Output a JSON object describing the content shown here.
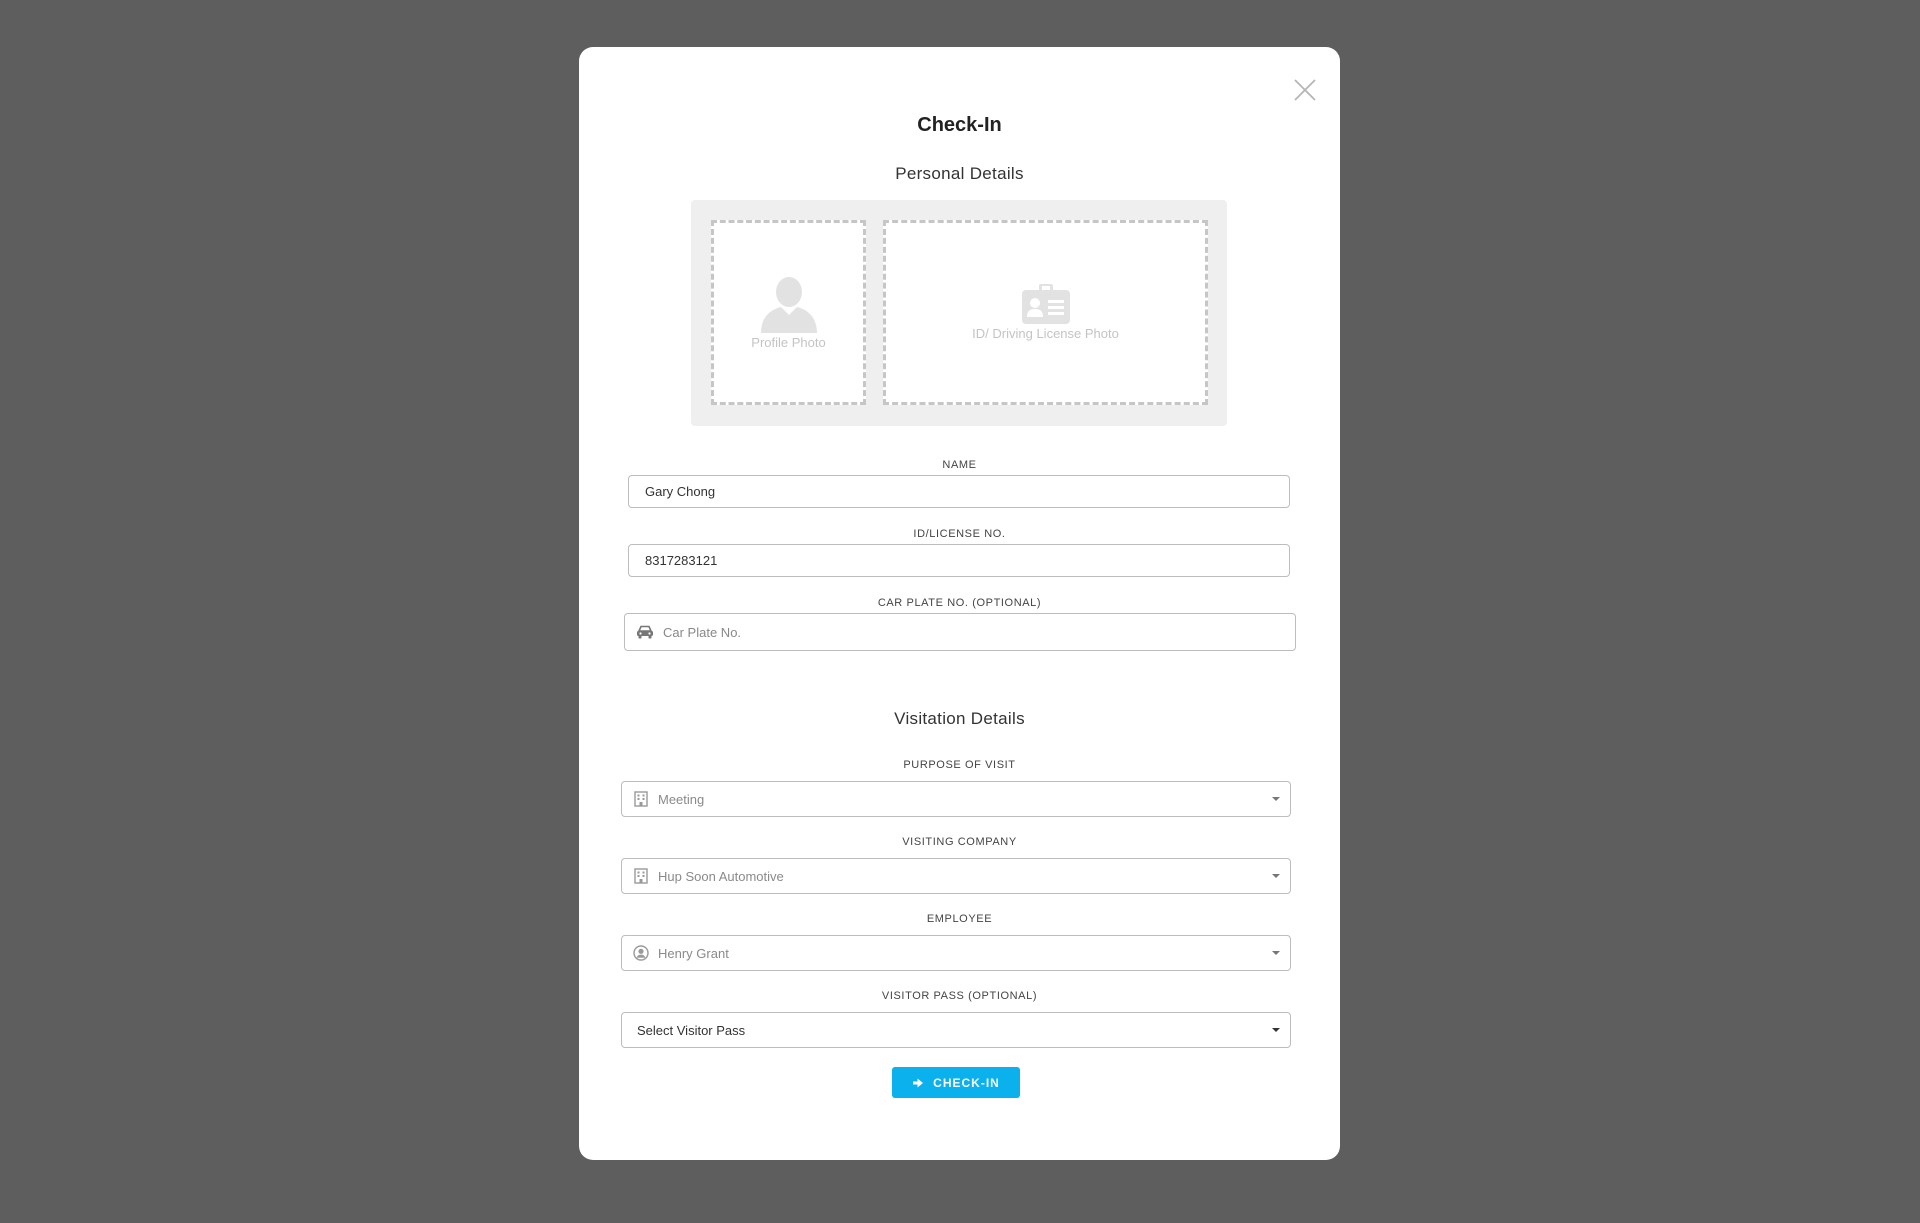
{
  "modal": {
    "title": "Check-In",
    "personal_section_title": "Personal Details",
    "visitation_section_title": "Visitation Details"
  },
  "photos": {
    "profile_label": "Profile Photo",
    "id_label": "ID/ Driving License Photo"
  },
  "fields": {
    "name": {
      "label": "NAME",
      "value": "Gary Chong"
    },
    "id_no": {
      "label": "ID/LICENSE NO.",
      "value": "8317283121"
    },
    "car_plate": {
      "label": "CAR PLATE NO. (OPTIONAL)",
      "placeholder": "Car Plate No."
    },
    "purpose": {
      "label": "PURPOSE OF VISIT",
      "value": "Meeting"
    },
    "company": {
      "label": "VISITING COMPANY",
      "value": "Hup Soon Automotive"
    },
    "employee": {
      "label": "EMPLOYEE",
      "value": "Henry Grant"
    },
    "visitor_pass": {
      "label": "VISITOR PASS (OPTIONAL)",
      "value": "Select Visitor Pass"
    }
  },
  "actions": {
    "checkin_label": "CHECK-IN"
  },
  "colors": {
    "backdrop": "#5e5e5e",
    "accent": "#0ab1ec",
    "placeholder_grey": "#c4c4c4"
  }
}
